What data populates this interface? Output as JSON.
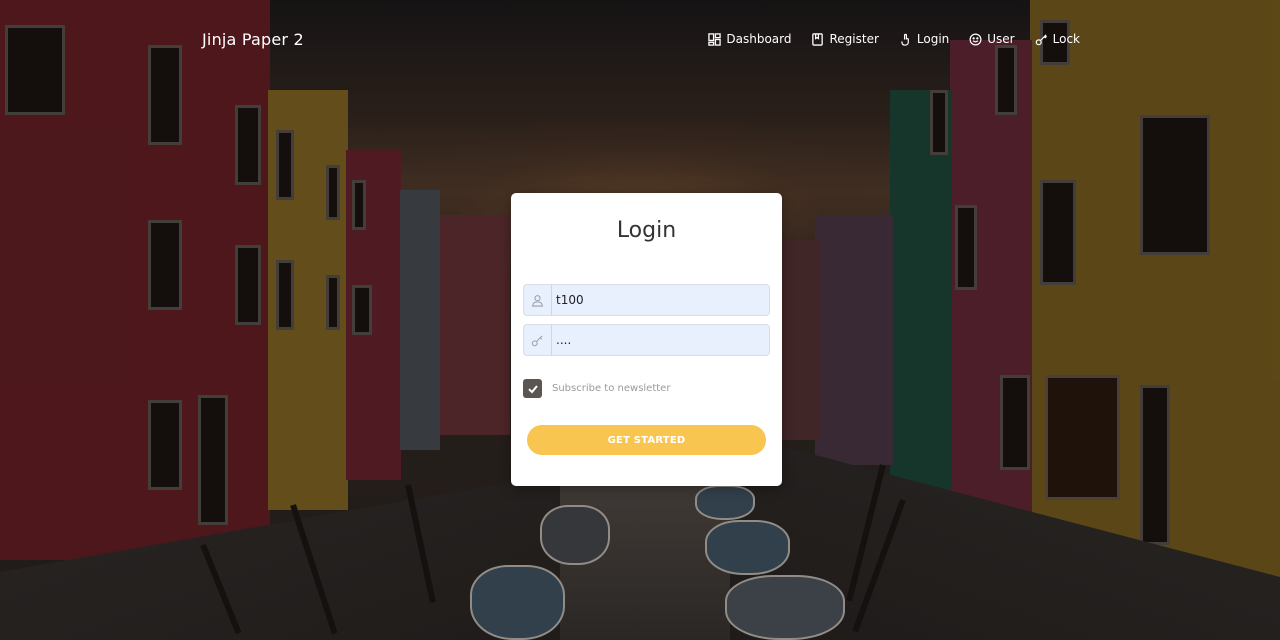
{
  "brand": {
    "title": "Jinja Paper 2"
  },
  "nav": {
    "items": [
      {
        "label": "Dashboard",
        "icon": "dashboard-icon"
      },
      {
        "label": "Register",
        "icon": "book-icon"
      },
      {
        "label": "Login",
        "icon": "tap-icon"
      },
      {
        "label": "User",
        "icon": "smiley-icon"
      },
      {
        "label": "Lock",
        "icon": "key-icon"
      }
    ]
  },
  "login": {
    "title": "Login",
    "username_value": "t100",
    "password_value": "....",
    "subscribe_label": "Subscribe to newsletter",
    "subscribe_checked": true,
    "submit_label": "GET STARTED"
  },
  "colors": {
    "button": "#f8c551",
    "input_bg": "#e8f0fe",
    "checkbox": "#5b5652"
  }
}
